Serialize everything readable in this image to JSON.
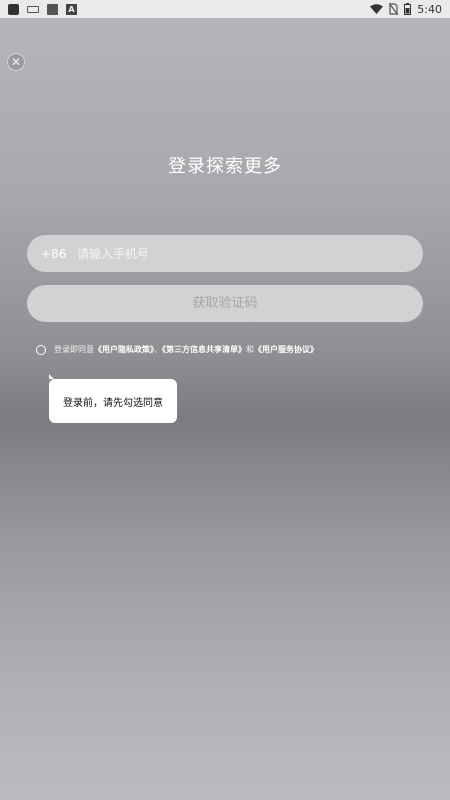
{
  "status_bar": {
    "time": "5:40",
    "left_icons": [
      "app-icon",
      "keyboard-icon",
      "image-icon",
      "font-a-icon"
    ],
    "right_icons": [
      "wifi-icon",
      "no-sim-icon",
      "battery-icon"
    ]
  },
  "page": {
    "title": "登录探索更多"
  },
  "login": {
    "country_code": "+86",
    "phone_placeholder": "请输入手机号",
    "phone_value": "",
    "get_code_label": "获取验证码"
  },
  "agreement": {
    "prefix": "登录即同意",
    "privacy_policy": "《用户隐私政策》",
    "separator": "、",
    "third_party": "《第三方信息共享清单》",
    "and": "和",
    "service_agreement": "《用户服务协议》",
    "checked": false
  },
  "tooltip": {
    "text": "登录前，请先勾选同意"
  }
}
